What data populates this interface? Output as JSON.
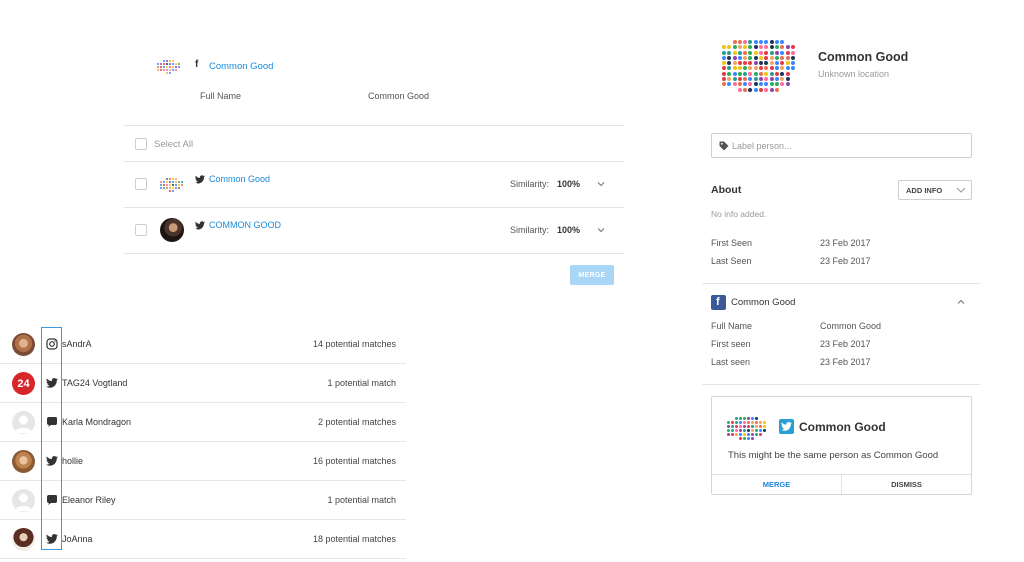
{
  "merge_panel": {
    "header": {
      "network": "facebook",
      "account_name": "Common Good",
      "field_label": "Full Name",
      "field_value": "Common Good"
    },
    "select_all_label": "Select All",
    "matches": [
      {
        "network": "twitter",
        "account_name": "Common Good",
        "similarity_label": "Similarity:",
        "similarity_value": "100%"
      },
      {
        "network": "twitter",
        "account_name": "COMMON GOOD",
        "similarity_label": "Similarity:",
        "similarity_value": "100%"
      }
    ],
    "merge_label": "MERGE"
  },
  "people_list": [
    {
      "network": "instagram",
      "name": "sAndrA",
      "matches": "14 potential matches"
    },
    {
      "network": "twitter",
      "name": "TAG24 Vogtland",
      "matches": "1 potential match",
      "avatar_text": "24"
    },
    {
      "network": "chat",
      "name": "Karla Mondragon",
      "matches": "2 potential matches"
    },
    {
      "network": "twitter",
      "name": "hollie",
      "matches": "16 potential matches"
    },
    {
      "network": "chat",
      "name": "Eleanor Riley",
      "matches": "1 potential match"
    },
    {
      "network": "twitter",
      "name": "JoAnna",
      "matches": "18 potential matches"
    }
  ],
  "profile": {
    "name": "Common Good",
    "location": "Unknown location",
    "label_placeholder": "Label person...",
    "about_title": "About",
    "add_info_label": "ADD INFO",
    "no_info": "No info added.",
    "first_seen_label": "First Seen",
    "first_seen_value": "23 Feb 2017",
    "last_seen_label": "Last Seen",
    "last_seen_value": "23 Feb 2017",
    "facebook_section": {
      "title": "Common Good",
      "full_name_label": "Full Name",
      "full_name_value": "Common Good",
      "first_seen_label": "First seen",
      "first_seen_value": "23 Feb 2017",
      "last_seen_label": "Last seen",
      "last_seen_value": "23 Feb 2017"
    },
    "suggestion_card": {
      "account_name": "Common Good",
      "message": "This might be the same person as Common Good",
      "merge_label": "MERGE",
      "dismiss_label": "DISMISS"
    }
  },
  "colors": {
    "accent": "#1c8ad8",
    "facebook": "#3b5998",
    "twitter": "#2a9fd6",
    "merge_disabled": "#a9d6f7"
  }
}
